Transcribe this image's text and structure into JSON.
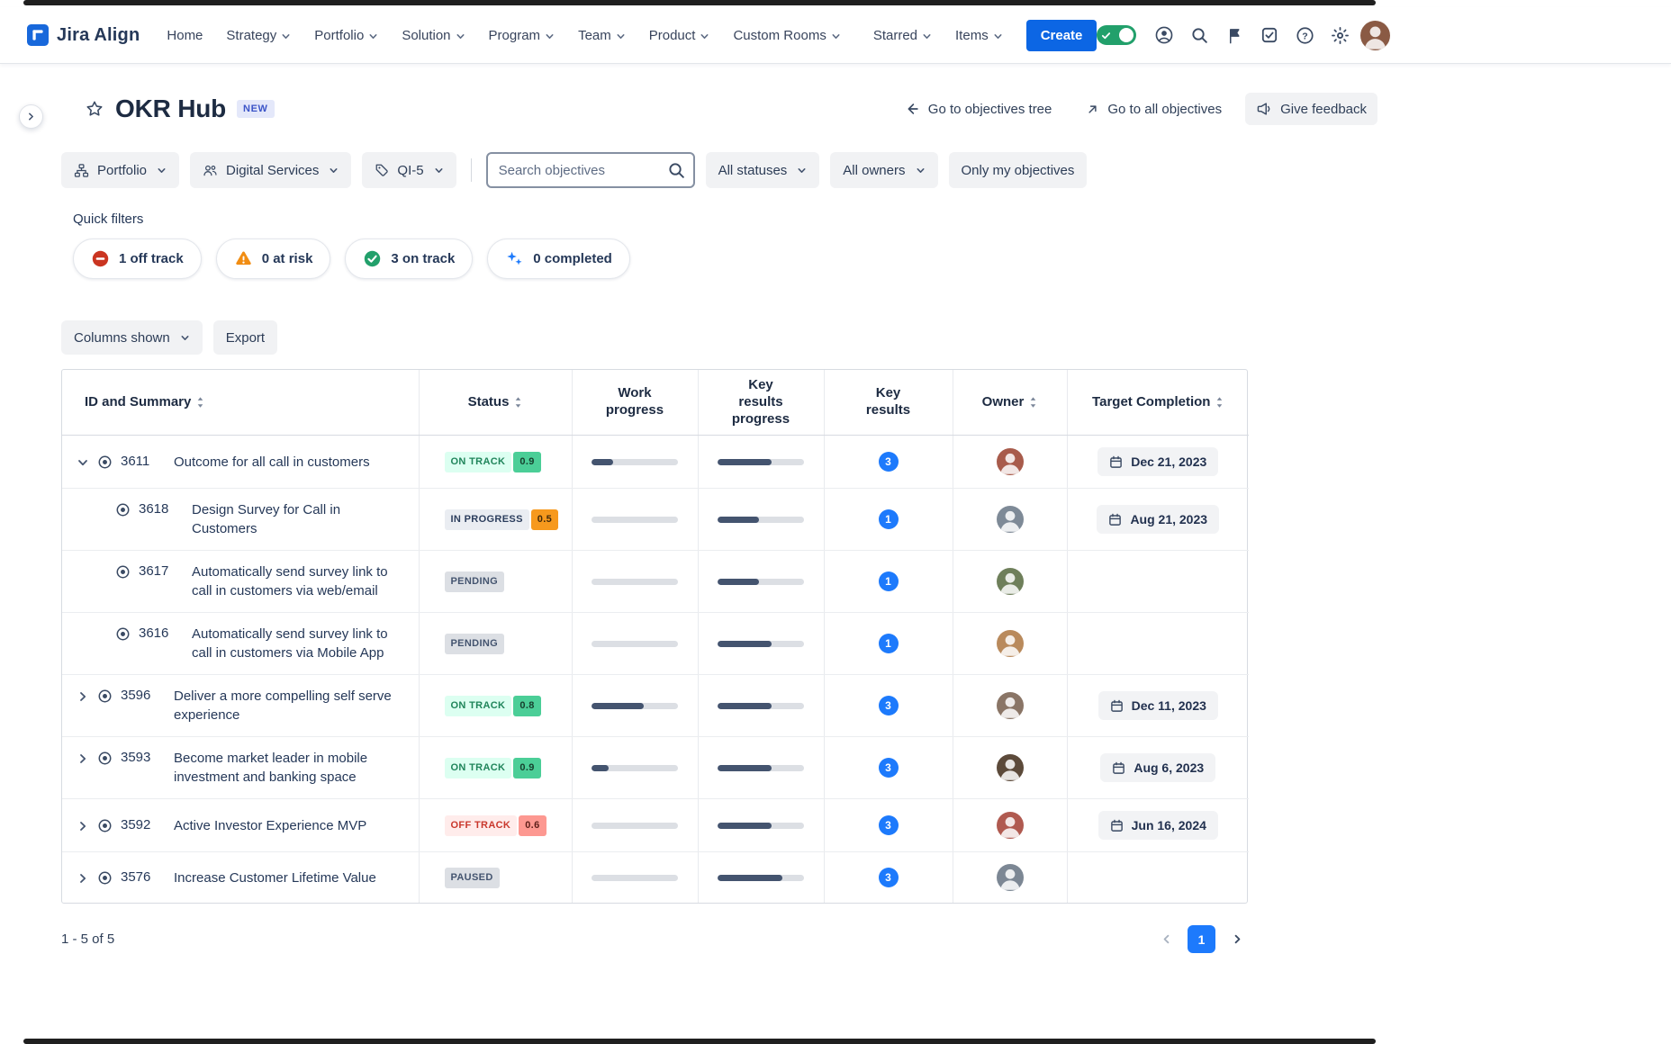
{
  "navbar": {
    "brand": "Jira Align",
    "items": [
      {
        "label": "Home",
        "dropdown": false
      },
      {
        "label": "Strategy",
        "dropdown": true
      },
      {
        "label": "Portfolio",
        "dropdown": true
      },
      {
        "label": "Solution",
        "dropdown": true
      },
      {
        "label": "Program",
        "dropdown": true
      },
      {
        "label": "Team",
        "dropdown": true
      },
      {
        "label": "Product",
        "dropdown": true
      },
      {
        "label": "Custom Rooms",
        "dropdown": true
      }
    ],
    "secondary_items": [
      {
        "label": "Starred",
        "dropdown": true
      },
      {
        "label": "Items",
        "dropdown": true
      }
    ],
    "create_label": "Create",
    "utility_icons": [
      "feature-toggle",
      "account",
      "search",
      "flag",
      "tasks",
      "help",
      "settings",
      "user-avatar"
    ],
    "avatar_color": "#8A5A44"
  },
  "header": {
    "title": "OKR Hub",
    "badge": "NEW",
    "actions": [
      {
        "label": "Go to objectives tree",
        "icon": "arrow-left",
        "style": "link"
      },
      {
        "label": "Go to all objectives",
        "icon": "arrow-up-right",
        "style": "link"
      },
      {
        "label": "Give feedback",
        "icon": "megaphone",
        "style": "button"
      }
    ]
  },
  "filters": {
    "dropdowns": [
      {
        "label": "Portfolio",
        "icon": "hierarchy"
      },
      {
        "label": "Digital Services",
        "icon": "team"
      },
      {
        "label": "QI-5",
        "icon": "tag"
      }
    ],
    "search_placeholder": "Search objectives",
    "selects": [
      {
        "label": "All statuses"
      },
      {
        "label": "All owners"
      }
    ],
    "toggle_button": "Only my objectives",
    "quick_filters_label": "Quick filters",
    "quick_filters": [
      {
        "label": "1 off track",
        "icon": "off-track"
      },
      {
        "label": "0 at risk",
        "icon": "at-risk"
      },
      {
        "label": "3 on track",
        "icon": "on-track"
      },
      {
        "label": "0 completed",
        "icon": "completed"
      }
    ]
  },
  "toolbar": {
    "columns_label": "Columns shown",
    "export_label": "Export"
  },
  "table": {
    "columns": [
      {
        "label": "ID and Summary",
        "sortable": true
      },
      {
        "label": "Status",
        "sortable": true
      },
      {
        "label": "Work progress",
        "sortable": false
      },
      {
        "label": "Key results progress",
        "sortable": false
      },
      {
        "label": "Key results",
        "sortable": false
      },
      {
        "label": "Owner",
        "sortable": true
      },
      {
        "label": "Target Completion",
        "sortable": true
      }
    ],
    "status_styles": {
      "on-track": {
        "bg": "#DCFFF1",
        "text": "#1F845A",
        "chip_bg": "#4BCE97",
        "chip_text": "#17402E"
      },
      "in-progress": {
        "bg": "#EAEDF2",
        "text": "#2C3E5D",
        "chip_bg": "#F7991D",
        "chip_text": "#42290A"
      },
      "pending": {
        "bg": "#DCDFE4",
        "text": "#44546F",
        "chip_bg": null,
        "chip_text": null
      },
      "off-track": {
        "bg": "#FFECEB",
        "text": "#C9372C",
        "chip_bg": "#FD9891",
        "chip_text": "#5D1F1A"
      },
      "paused": {
        "bg": "#DCDFE4",
        "text": "#44546F",
        "chip_bg": null,
        "chip_text": null
      }
    },
    "rows": [
      {
        "id": "3611",
        "summary": "Outcome for all call in customers",
        "expand": "expanded",
        "child": false,
        "status": {
          "type": "on-track",
          "label": "ON TRACK",
          "score": "0.9"
        },
        "work_progress": 0.25,
        "key_results_progress": 0.62,
        "key_results_count": "3",
        "target_completion": "Dec 21, 2023",
        "avatar_color": "#A85B4B"
      },
      {
        "id": "3618",
        "summary": "Design Survey for Call in Customers",
        "expand": null,
        "child": true,
        "status": {
          "type": "in-progress",
          "label": "IN PROGRESS",
          "score": "0.5"
        },
        "work_progress": 0,
        "key_results_progress": 0.48,
        "key_results_count": "1",
        "target_completion": "Aug 21, 2023",
        "avatar_color": "#7E8A97"
      },
      {
        "id": "3617",
        "summary": "Automatically send survey link to call in customers via web/email",
        "expand": null,
        "child": true,
        "status": {
          "type": "pending",
          "label": "PENDING",
          "score": null
        },
        "work_progress": 0,
        "key_results_progress": 0.48,
        "key_results_count": "1",
        "target_completion": "",
        "avatar_color": "#6E7F5A"
      },
      {
        "id": "3616",
        "summary": "Automatically send survey link to call in customers via Mobile App",
        "expand": null,
        "child": true,
        "status": {
          "type": "pending",
          "label": "PENDING",
          "score": null
        },
        "work_progress": 0,
        "key_results_progress": 0.62,
        "key_results_count": "1",
        "target_completion": "",
        "avatar_color": "#B98A5C"
      },
      {
        "id": "3596",
        "summary": "Deliver a more compelling self serve experience",
        "expand": "collapsed",
        "child": false,
        "status": {
          "type": "on-track",
          "label": "ON TRACK",
          "score": "0.8"
        },
        "work_progress": 0.6,
        "key_results_progress": 0.62,
        "key_results_count": "3",
        "target_completion": "Dec 11, 2023",
        "avatar_color": "#8A7566"
      },
      {
        "id": "3593",
        "summary": "Become market leader in mobile investment and banking space",
        "expand": "collapsed",
        "child": false,
        "status": {
          "type": "on-track",
          "label": "ON TRACK",
          "score": "0.9"
        },
        "work_progress": 0.2,
        "key_results_progress": 0.62,
        "key_results_count": "3",
        "target_completion": "Aug 6, 2023",
        "avatar_color": "#5C4A3A"
      },
      {
        "id": "3592",
        "summary": "Active Investor Experience MVP",
        "expand": "collapsed",
        "child": false,
        "status": {
          "type": "off-track",
          "label": "OFF TRACK",
          "score": "0.6"
        },
        "work_progress": 0,
        "key_results_progress": 0.62,
        "key_results_count": "3",
        "target_completion": "Jun 16, 2024",
        "avatar_color": "#B05A50"
      },
      {
        "id": "3576",
        "summary": "Increase Customer Lifetime Value",
        "expand": "collapsed",
        "child": false,
        "status": {
          "type": "paused",
          "label": "PAUSED",
          "score": null
        },
        "work_progress": 0,
        "key_results_progress": 0.75,
        "key_results_count": "3",
        "target_completion": "",
        "avatar_color": "#7C8794"
      }
    ]
  },
  "footer": {
    "count": "1 - 5 of 5",
    "page": "1"
  },
  "colors": {
    "accent": "#0C66E4",
    "brand_blue": "#1868DB",
    "heading": "#172B4D",
    "progress_fill": "#44546F",
    "progress_track": "#DCDFE4",
    "key_results_badge": "#1D7AFC",
    "border": "#D7DBE1",
    "toggle_on_green": "#22A06B",
    "new_badge_bg": "#E4E8FA",
    "new_badge_text": "#3C55C8"
  }
}
